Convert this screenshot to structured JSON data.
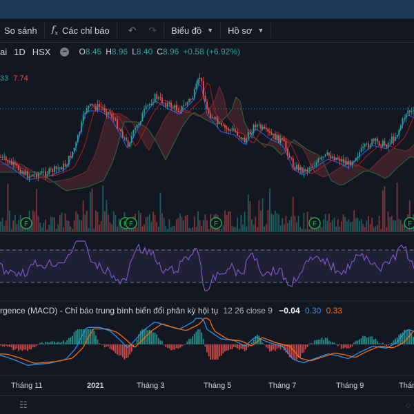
{
  "toolbar": {
    "compare": "So sánh",
    "indicators": "Các chỉ báo",
    "chart_type": "Biểu đồ",
    "profile": "Hồ sơ"
  },
  "legend": {
    "symbol_partial": "ai",
    "interval": "1D",
    "exchange": "HSX",
    "o_label": "O",
    "o": "8.45",
    "h_label": "H",
    "h": "8.96",
    "l_label": "L",
    "l": "8.40",
    "c_label": "C",
    "c": "8.96",
    "change": "+0.58 (+6.92%)"
  },
  "ind2": {
    "v1": "33",
    "v2": "7.74"
  },
  "macd": {
    "title": "rgence (MACD) - Chỉ báo trung bình biến đổi phân kỳ hội tụ",
    "params": "12 26 close 9",
    "v1": "−0.04",
    "v2": "0.30",
    "v3": "0.33"
  },
  "xaxis": [
    "Tháng 11",
    "2021",
    "Tháng 3",
    "Tháng 5",
    "Tháng 7",
    "Tháng 9",
    "Tháng"
  ],
  "events": [
    "F",
    "F",
    "F",
    "F",
    "F",
    "F"
  ],
  "colors": {
    "up": "#26a69a",
    "down": "#ef5350",
    "rsi": "#7e57c2",
    "macd": "#2196f3",
    "signal": "#ff6d00"
  }
}
